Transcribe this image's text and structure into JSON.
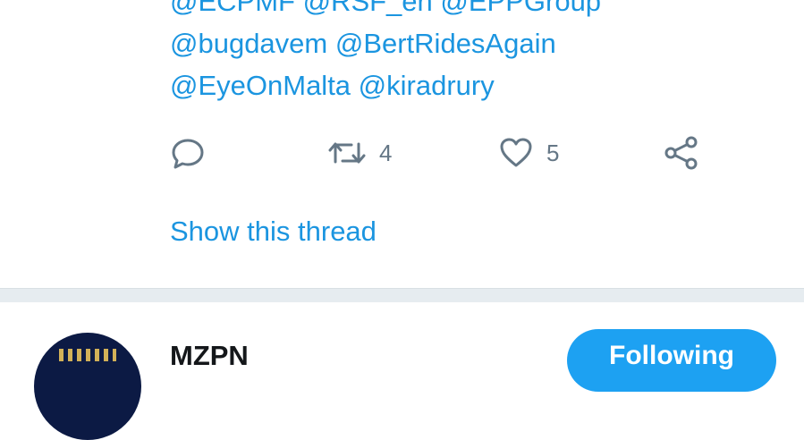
{
  "tweet": {
    "mention_lines": [
      "@ECPMF @RSF_en @EPPGroup",
      "@bugdavem @BertRidesAgain",
      "@EyeOnMalta @kiradrury"
    ],
    "actions": {
      "retweet_count": "4",
      "like_count": "5"
    },
    "show_thread": "Show this thread"
  },
  "next_tweet": {
    "author_name": "MZPN",
    "follow_label": "Following"
  },
  "colors": {
    "link": "#1b95e0",
    "icon": "#657786",
    "divider": "#e6ecf0",
    "button": "#1da1f2"
  }
}
